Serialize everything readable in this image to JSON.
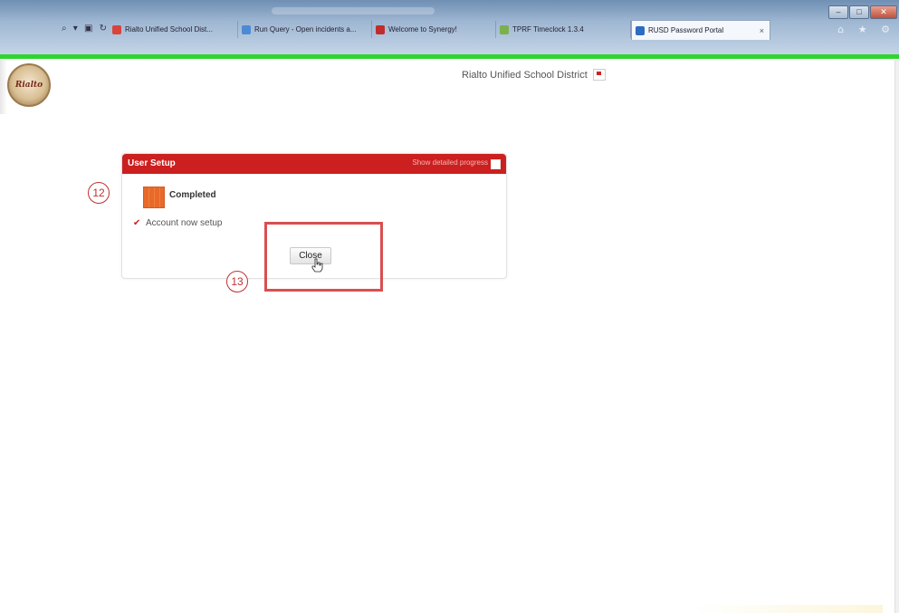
{
  "browser": {
    "address_icons": "⌕ ▾ ▣ ↻",
    "tabs": [
      {
        "label": "Rialto Unified School Dist...",
        "favicon_color": "#d9443a"
      },
      {
        "label": "Run Query - Open incidents a...",
        "favicon_color": "#4d8ad6"
      },
      {
        "label": "Welcome to Synergy!",
        "favicon_color": "#c02c2c"
      },
      {
        "label": "TPRF Timeclock 1.3.4",
        "favicon_color": "#7bb04a"
      },
      {
        "label": "RUSD Password Portal",
        "favicon_color": "#2b6cc4",
        "active": true
      }
    ],
    "tab_close": "×",
    "window_controls": {
      "minimize": "–",
      "maximize": "□",
      "close": "✕"
    },
    "toolbar_icons": "⌂ ★ ⚙"
  },
  "header": {
    "district_name": "Rialto Unified School District",
    "logo_text": "Rialto"
  },
  "dialog": {
    "title": "User Setup",
    "detail_link": "Show detailed progress",
    "status": "Completed",
    "result_check": "✔",
    "result": "Account now setup",
    "close_button": "Close"
  },
  "annotations": {
    "step_12": "12",
    "step_13": "13"
  },
  "colors": {
    "header_red": "#cc1f1f",
    "accent_green": "#2fd52f",
    "status_orange": "#e8692a",
    "annotation_red": "#d94f4f"
  }
}
